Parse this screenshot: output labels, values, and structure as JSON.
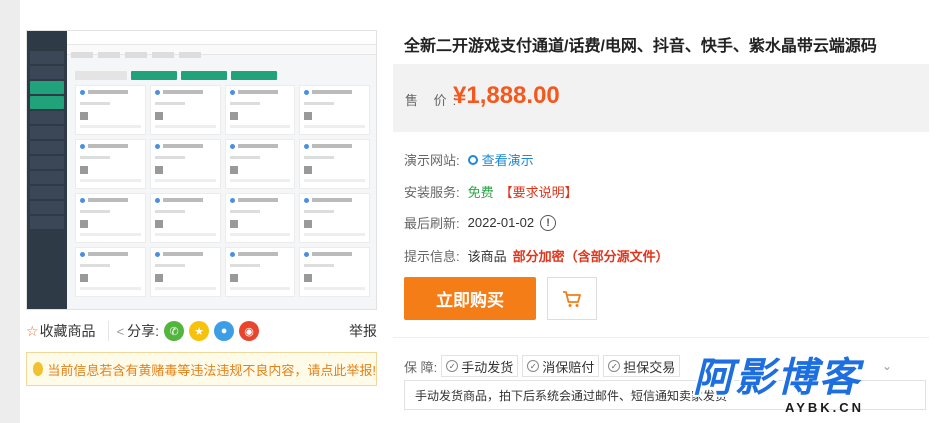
{
  "product": {
    "title": "全新二开游戏支付通道/话费/电网、抖音、快手、紫水晶带云端源码",
    "price_label": "售 价:",
    "price": "¥1,888.00"
  },
  "info": {
    "demo_label": "演示网站:",
    "demo_link": "查看演示",
    "install_label": "安装服务:",
    "install_value": "免费",
    "install_link": "【要求说明】",
    "refresh_label": "最后刷新:",
    "refresh_date": "2022-01-02",
    "tip_label": "提示信息:",
    "tip_prefix": "该商品",
    "tip_emphasis": "部分加密（含部分源文件）"
  },
  "actions": {
    "buy_label": "立即购买"
  },
  "guarantee": {
    "label": "保 障:",
    "tags": [
      "手动发货",
      "消保赔付",
      "担保交易"
    ],
    "desc": "手动发货商品，拍下后系统会通过邮件、短信通知卖家发货"
  },
  "share": {
    "fav_label": "收藏商品",
    "share_label": "分享:",
    "report_label": "举报"
  },
  "warning": {
    "text": "当前信息若含有黄赌毒等违法违规不良内容，请点此举报!"
  },
  "watermark": {
    "big": "阿影博客",
    "small": "AYBK.CN"
  },
  "colors": {
    "accent": "#f47d18",
    "price": "#f4581c",
    "link": "#1e88d6",
    "green": "#2aa544",
    "red": "#e0351b"
  }
}
